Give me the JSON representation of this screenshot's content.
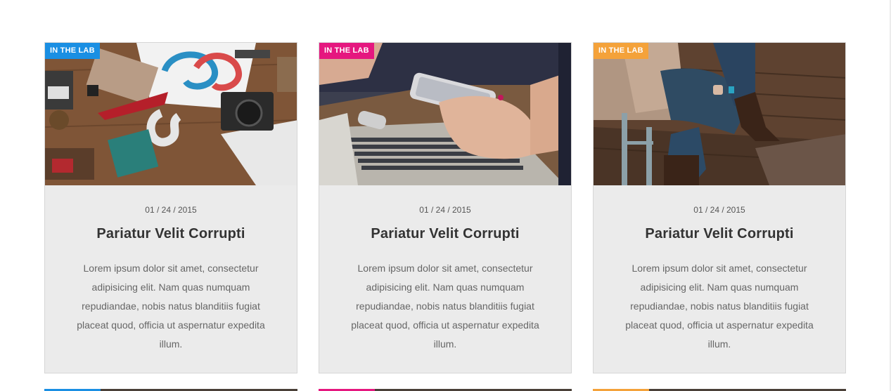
{
  "cards": [
    {
      "badge": "IN THE LAB",
      "badge_color": "#1a8fe3",
      "image_icon": "desk-flatlay-image",
      "date": "01 / 24 / 2015",
      "title": "Pariatur Velit Corrupti",
      "excerpt": "Lorem ipsum dolor sit amet, consectetur adipisicing elit. Nam quas numquam repudiandae, nobis natus blanditiis fugiat placeat quod, officia ut aspernatur expedita illum."
    },
    {
      "badge": "IN THE LAB",
      "badge_color": "#e5177f",
      "image_icon": "phone-laptop-image",
      "date": "01 / 24 / 2015",
      "title": "Pariatur Velit Corrupti",
      "excerpt": "Lorem ipsum dolor sit amet, consectetur adipisicing elit. Nam quas numquam repudiandae, nobis natus blanditiis fugiat placeat quod, officia ut aspernatur expedita illum."
    },
    {
      "badge": "IN THE LAB",
      "badge_color": "#f4a23a",
      "image_icon": "sitting-person-image",
      "date": "01 / 24 / 2015",
      "title": "Pariatur Velit Corrupti",
      "excerpt": "Lorem ipsum dolor sit amet, consectetur adipisicing elit. Nam quas numquam repudiandae, nobis natus blanditiis fugiat placeat quod, officia ut aspernatur expedita illum."
    }
  ]
}
